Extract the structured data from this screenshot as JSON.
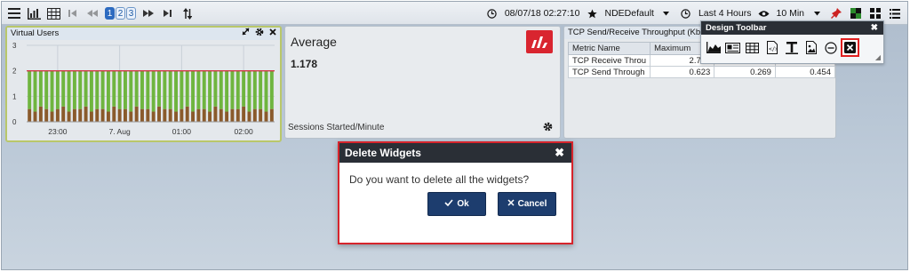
{
  "toolbar": {
    "pages": [
      "1",
      "2",
      "3"
    ],
    "active_page": "1",
    "datetime": "08/07/18 02:27:10",
    "favorite": "NDEDefault",
    "time_range": "Last 4 Hours",
    "refresh": "10 Min"
  },
  "widgets": {
    "virtual_users": {
      "title": "Virtual Users",
      "chart_data": {
        "type": "bar",
        "stacked": true,
        "yticks": [
          "0",
          "1",
          "2",
          "3"
        ],
        "ylim": [
          0,
          3
        ],
        "xticks": [
          "23:00",
          "7. Aug",
          "01:00",
          "02:00"
        ],
        "series": [
          {
            "values": [
              0.5,
              0.4,
              0.6,
              0.5,
              0.4,
              0.5,
              0.6,
              0.4,
              0.5,
              0.5,
              0.6,
              0.4,
              0.5,
              0.5,
              0.4,
              0.6,
              0.5,
              0.5,
              0.4,
              0.6,
              0.5,
              0.5,
              0.4,
              0.6,
              0.5,
              0.5,
              0.4,
              0.5,
              0.6,
              0.4,
              0.5,
              0.5,
              0.4,
              0.6,
              0.5,
              0.4,
              0.5,
              0.5,
              0.6,
              0.4,
              0.5,
              0.5,
              0.4,
              0.5
            ]
          },
          {
            "values": [
              1.5,
              1.6,
              1.4,
              1.5,
              1.6,
              1.5,
              1.4,
              1.6,
              1.5,
              1.5,
              1.4,
              1.6,
              1.5,
              1.5,
              1.6,
              1.4,
              1.5,
              1.5,
              1.6,
              1.4,
              1.5,
              1.5,
              1.6,
              1.4,
              1.5,
              1.5,
              1.6,
              1.5,
              1.4,
              1.6,
              1.5,
              1.5,
              1.6,
              1.4,
              1.5,
              1.6,
              1.5,
              1.5,
              1.4,
              1.6,
              1.5,
              1.5,
              1.6,
              1.5
            ]
          }
        ],
        "line_value": 2,
        "colors": {
          "bottom": "#8a5a2b",
          "top": "#6fb53f",
          "line": "#d13a4a"
        }
      }
    },
    "average": {
      "title": "Average",
      "value": "1.178",
      "subtitle": "Sessions Started/Minute"
    },
    "tcp": {
      "title": "TCP Send/Receive Throughput (Kbps)",
      "columns": [
        "Metric Name",
        "Maximum"
      ],
      "rows": [
        {
          "name": "TCP Receive Throu",
          "max": "2.755",
          "c3": "",
          "c4": ""
        },
        {
          "name": "TCP Send Through",
          "max": "0.623",
          "c3": "0.269",
          "c4": "0.454"
        }
      ]
    }
  },
  "design_toolbar": {
    "title": "Design Toolbar",
    "icons": [
      "area-chart-icon",
      "news-widget-icon",
      "table-widget-icon",
      "code-file-icon",
      "text-icon",
      "image-icon",
      "minus-circle-icon",
      "delete-all-icon"
    ]
  },
  "dialog": {
    "title": "Delete Widgets",
    "message": "Do you want to delete all the widgets?",
    "ok_label": "Ok",
    "cancel_label": "Cancel"
  },
  "colors": {
    "accent": "#1d3d6e",
    "danger": "#d6242c",
    "dark_header": "#2a2f36"
  }
}
